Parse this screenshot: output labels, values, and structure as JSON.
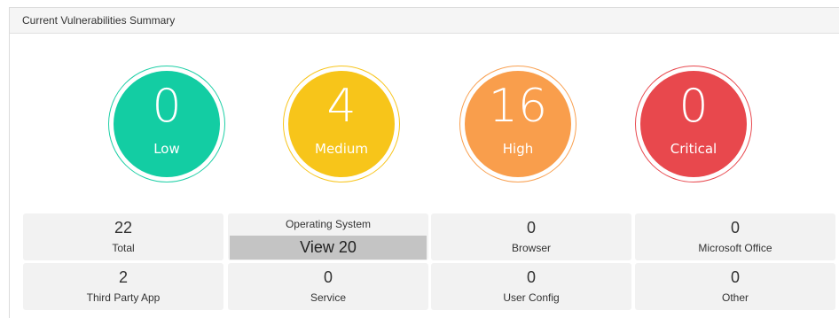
{
  "panel": {
    "title": "Current Vulnerabilities Summary"
  },
  "severities": {
    "low": {
      "count": "0",
      "label": "Low",
      "color": "#13cda3"
    },
    "medium": {
      "count": "4",
      "label": "Medium",
      "color": "#f7c51a"
    },
    "high": {
      "count": "16",
      "label": "High",
      "color": "#f99e4c"
    },
    "critical": {
      "count": "0",
      "label": "Critical",
      "color": "#e8484d"
    }
  },
  "tiles": {
    "total": {
      "value": "22",
      "label": "Total"
    },
    "os": {
      "label": "Operating System",
      "button": "View 20"
    },
    "browser": {
      "value": "0",
      "label": "Browser"
    },
    "office": {
      "value": "0",
      "label": "Microsoft Office"
    },
    "third_party": {
      "value": "2",
      "label": "Third Party App"
    },
    "service": {
      "value": "0",
      "label": "Service"
    },
    "user_config": {
      "value": "0",
      "label": "User Config"
    },
    "other": {
      "value": "0",
      "label": "Other"
    }
  }
}
